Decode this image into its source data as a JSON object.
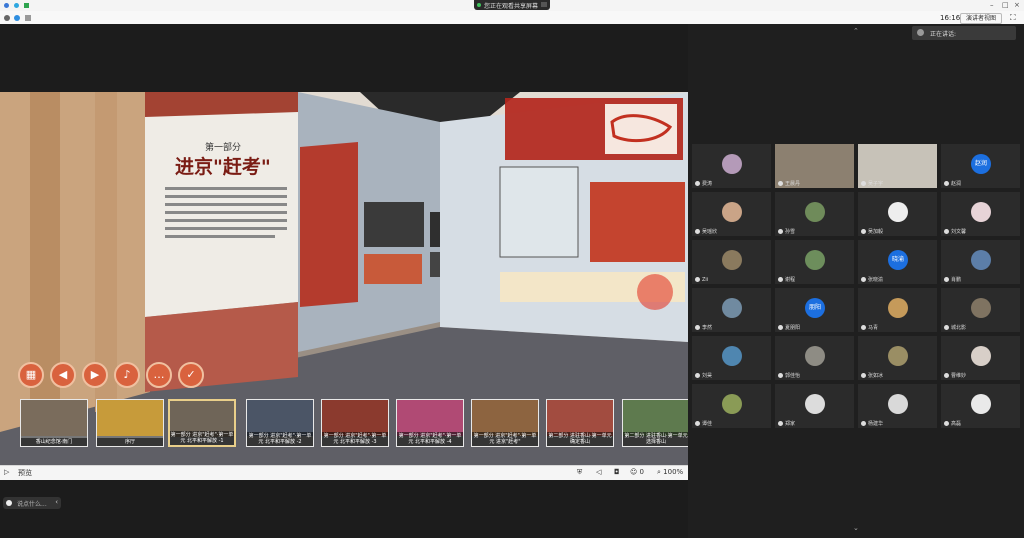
{
  "system": {
    "share_banner": "您正在观看共享屏幕",
    "clock": "16:16",
    "view_button": "演讲者视图"
  },
  "viewer": {
    "thumbnails": [
      {
        "caption": "香山纪念馆·南门",
        "color": "#7a6c5c"
      },
      {
        "caption": "序厅",
        "color": "#c79b3a"
      },
      {
        "caption": "第一部分 进京\"赶考\"·第一单元 北平和平解放 -1",
        "color": "#6f6558",
        "selected": true
      },
      {
        "caption": "第一部分 进京\"赶考\"·第一单元 北平和平解放 -2",
        "color": "#4b5566"
      },
      {
        "caption": "第一部分 进京\"赶考\"·第一单元 北平和平解放 -3",
        "color": "#8b3a2e"
      },
      {
        "caption": "第一部分 进京\"赶考\"·第一单元 北平和平解放 -4",
        "color": "#b04a74"
      },
      {
        "caption": "第一部分 进京\"赶考\"·第一单元 进京\"赶考\"",
        "color": "#8d6440"
      },
      {
        "caption": "第二部分 进驻香山·第一单元 确定香山",
        "color": "#a24c40"
      },
      {
        "caption": "第二部分 进驻香山·第一单元 选择香山",
        "color": "#5e7a4e"
      }
    ],
    "controls": [
      "grid",
      "prev",
      "next",
      "sound",
      "comment",
      "check"
    ],
    "exhibit_title": "进京\"赶考\"",
    "exhibit_part": "第一部分",
    "status_label": "预览",
    "zoom": "100%",
    "counter": "0"
  },
  "meeting": {
    "speaking_label": "正在讲话:",
    "chat_placeholder": "说点什么..."
  },
  "participants": [
    {
      "name": "费涛",
      "avatar": "photo",
      "color": "#b49ab8"
    },
    {
      "name": "王晨丹",
      "avatar": "video",
      "color": "#8c8070"
    },
    {
      "name": "吴子宇",
      "avatar": "video",
      "color": "#c7c2b8"
    },
    {
      "name": "赵润",
      "avatar": "text",
      "text": "赵润",
      "color": "#1c6fe0"
    },
    {
      "name": "吴瑶欣",
      "avatar": "photo",
      "color": "#caa487"
    },
    {
      "name": "孙雪",
      "avatar": "photo",
      "color": "#6f8b5a"
    },
    {
      "name": "吴加毅",
      "avatar": "photo",
      "color": "#eeeeee"
    },
    {
      "name": "刘文馨",
      "avatar": "photo",
      "color": "#e7d3d7"
    },
    {
      "name": "Zii",
      "avatar": "photo",
      "color": "#8a7a5e"
    },
    {
      "name": "谢程",
      "avatar": "photo",
      "color": "#6d8e5c"
    },
    {
      "name": "张晓渝",
      "avatar": "text",
      "text": "晓渝",
      "color": "#1c6fe0"
    },
    {
      "name": "肖鹏",
      "avatar": "photo",
      "color": "#5c7ea8"
    },
    {
      "name": "李然",
      "avatar": "photo",
      "color": "#708aa0"
    },
    {
      "name": "夏朋阳",
      "avatar": "text",
      "text": "朋阳",
      "color": "#1c6fe0"
    },
    {
      "name": "马青",
      "avatar": "photo",
      "color": "#c59a5a"
    },
    {
      "name": "城北影",
      "avatar": "photo",
      "color": "#7f7361"
    },
    {
      "name": "刘昊",
      "avatar": "photo",
      "color": "#4f86b0"
    },
    {
      "name": "郭佳怡",
      "avatar": "photo",
      "color": "#8e8c84"
    },
    {
      "name": "张如冰",
      "avatar": "photo",
      "color": "#9a8e64"
    },
    {
      "name": "曹维妙",
      "avatar": "photo",
      "color": "#d8cfc8"
    },
    {
      "name": "谭佳",
      "avatar": "photo",
      "color": "#8a9b56"
    },
    {
      "name": "郑家",
      "avatar": "photo",
      "color": "#dcdcdc"
    },
    {
      "name": "杨建华",
      "avatar": "photo",
      "color": "#d9d9d9"
    },
    {
      "name": "高磊",
      "avatar": "photo",
      "color": "#e9e9e9"
    }
  ]
}
